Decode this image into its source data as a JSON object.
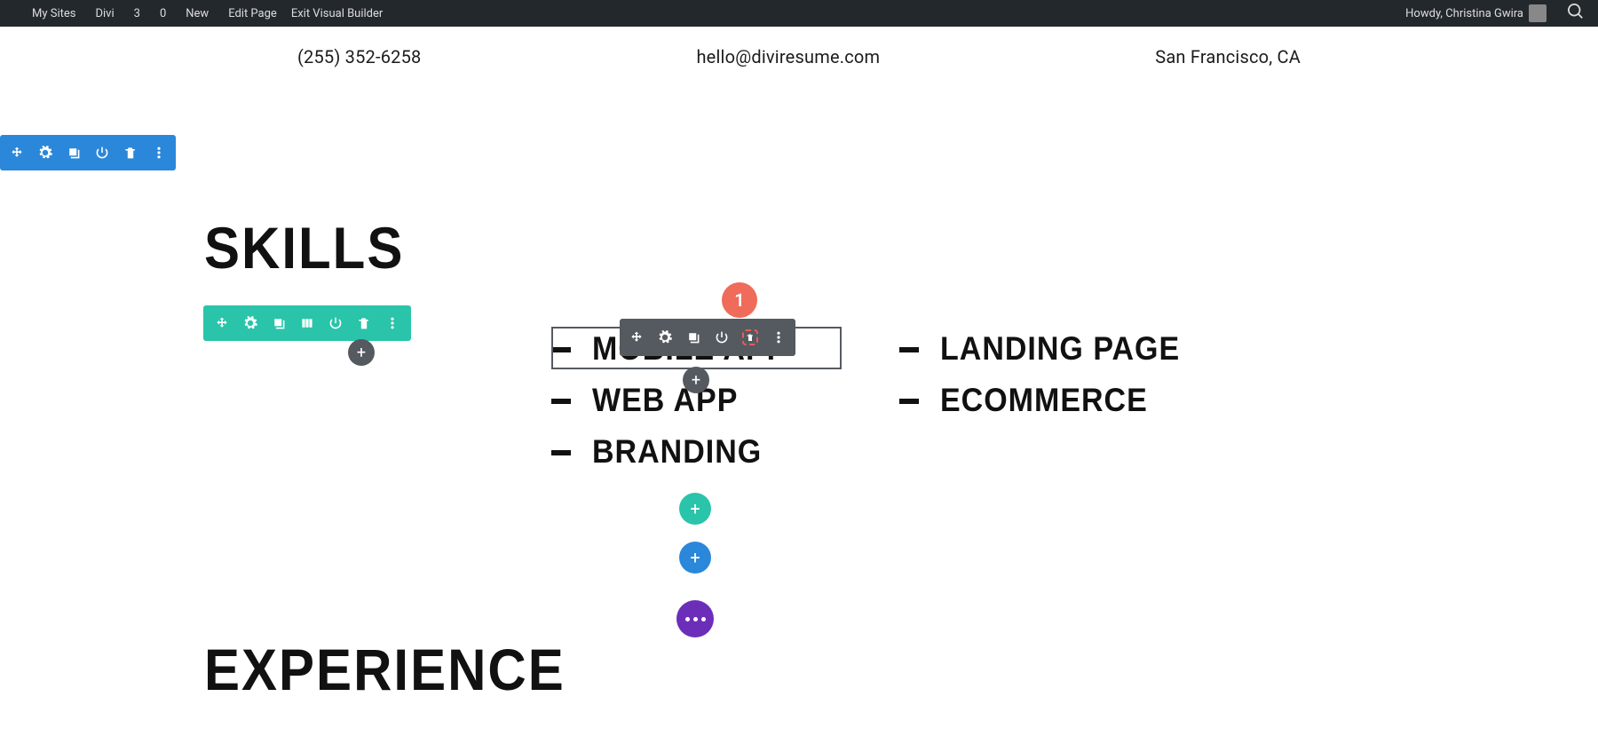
{
  "adminbar": {
    "mysites": "My Sites",
    "site": "Divi",
    "updates": "3",
    "comments": "0",
    "new": "New",
    "editpage": "Edit Page",
    "exitvb": "Exit Visual Builder",
    "greeting": "Howdy, Christina Gwira"
  },
  "contacts": {
    "phone": "(255) 352-6258",
    "email": "hello@diviresume.com",
    "location": "San Francisco, CA"
  },
  "headings": {
    "skills": "SKILLS",
    "experience": "EXPERIENCE"
  },
  "skills": {
    "mobile": "MOBILE APP",
    "webapp": "WEB APP",
    "branding": "BRANDING",
    "landing": "LANDING PAGE",
    "ecommerce": "ECOMMERCE"
  },
  "annotation": {
    "badge1": "1"
  },
  "symbols": {
    "plus": "+"
  }
}
